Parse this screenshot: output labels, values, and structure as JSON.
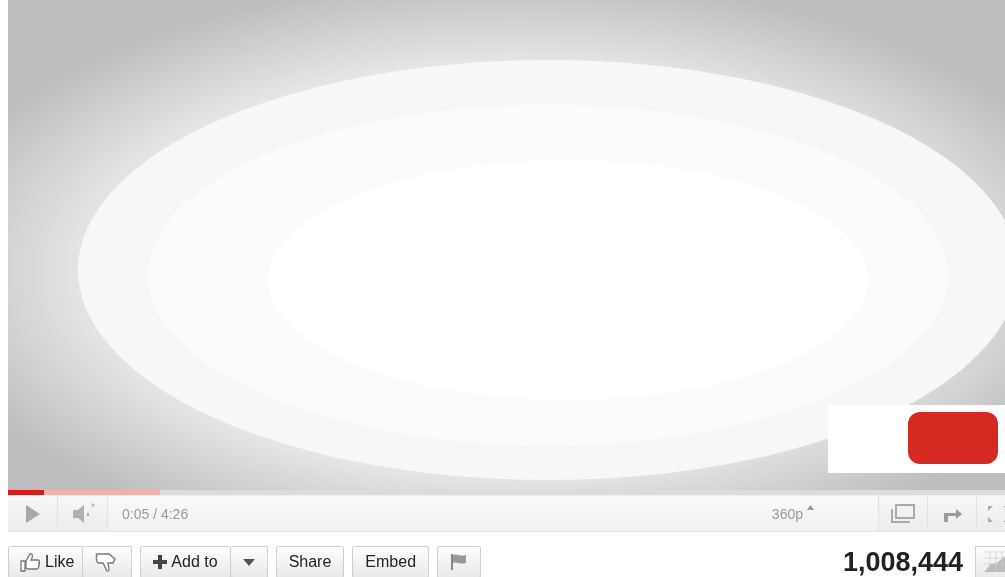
{
  "player": {
    "progress": {
      "played": {
        "level": 0.036
      },
      "loaded": {
        "level": 0.15
      }
    },
    "time": "0:05 / 4:26",
    "quality": "360p"
  },
  "actions": [
    {
      "kind": "like",
      "label": "Like",
      "attached": false
    },
    {
      "kind": "dislike",
      "attached": true
    },
    {
      "kind": "add",
      "label": "Add to",
      "attached": false
    },
    {
      "kind": "more",
      "attached": true
    },
    {
      "kind": "text",
      "label": "Share",
      "attached": false
    },
    {
      "kind": "text",
      "label": "Embed",
      "attached": false
    },
    {
      "kind": "flag",
      "attached": false
    }
  ],
  "views": "1,008,444"
}
